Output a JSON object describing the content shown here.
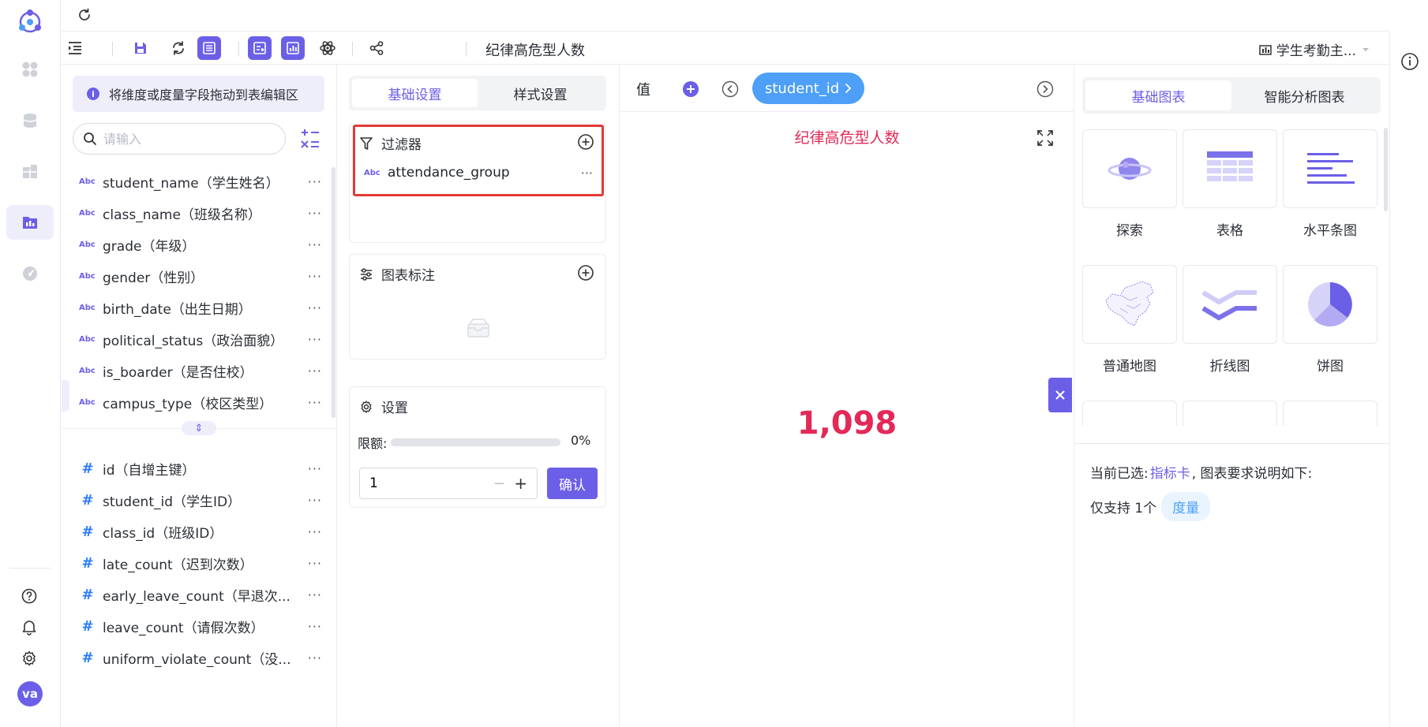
{
  "rail": {
    "items": [
      {
        "name": "rail-item-apps",
        "icon": "grid-icon",
        "active": false
      },
      {
        "name": "rail-item-datasource",
        "icon": "database-icon",
        "active": false
      },
      {
        "name": "rail-item-dataset",
        "icon": "table-icon",
        "active": false
      },
      {
        "name": "rail-item-analysis",
        "icon": "chart-folder-icon",
        "active": true
      },
      {
        "name": "rail-item-monitor",
        "icon": "gauge-icon",
        "active": false
      }
    ],
    "avatar": "va"
  },
  "toolbar": {
    "report_title": "纪律高危型人数",
    "dashboard": "学生考勤主..."
  },
  "fields_panel": {
    "hint": "将维度或度量字段拖动到表编辑区",
    "search_placeholder": "请输入",
    "dimensions": [
      {
        "type": "Abc",
        "label": "student_name（学生姓名）"
      },
      {
        "type": "Abc",
        "label": "class_name（班级名称）"
      },
      {
        "type": "Abc",
        "label": "grade（年级）"
      },
      {
        "type": "Abc",
        "label": "gender（性别）"
      },
      {
        "type": "Abc",
        "label": "birth_date（出生日期）"
      },
      {
        "type": "Abc",
        "label": "political_status（政治面貌）"
      },
      {
        "type": "Abc",
        "label": "is_boarder（是否住校）"
      },
      {
        "type": "Abc",
        "label": "campus_type（校区类型）"
      }
    ],
    "measures": [
      {
        "type": "#",
        "label": "id（自增主键）"
      },
      {
        "type": "#",
        "label": "student_id（学生ID）"
      },
      {
        "type": "#",
        "label": "class_id（班级ID）"
      },
      {
        "type": "#",
        "label": "late_count（迟到次数）"
      },
      {
        "type": "#",
        "label": "early_leave_count（早退次..."
      },
      {
        "type": "#",
        "label": "leave_count（请假次数）"
      },
      {
        "type": "#",
        "label": "uniform_violate_count（没..."
      }
    ],
    "more": "···"
  },
  "settings_panel": {
    "tabs": [
      "基础设置",
      "样式设置"
    ],
    "active_tab": 0,
    "filter": {
      "title": "过滤器",
      "item_type": "Abc",
      "item_label": "attendance_group"
    },
    "annotation": {
      "title": "图表标注"
    },
    "config": {
      "title": "设置",
      "quota_label": "限额:",
      "quota_value": 0,
      "quota_text": "0%",
      "input_value": "1",
      "confirm_label": "确认"
    }
  },
  "canvas": {
    "value_label": "值",
    "field_pill": "student_id",
    "chart_title": "纪律高危型人数",
    "metric_value": "1,098"
  },
  "chart_picker": {
    "tabs": [
      "基础图表",
      "智能分析图表"
    ],
    "active_tab": 0,
    "tiles": [
      {
        "label": "探索",
        "icon": "explore-planet-icon"
      },
      {
        "label": "表格",
        "icon": "table-chart-icon"
      },
      {
        "label": "水平条图",
        "icon": "horizontal-bar-icon"
      },
      {
        "label": "普通地图",
        "icon": "china-map-icon"
      },
      {
        "label": "折线图",
        "icon": "line-chart-icon"
      },
      {
        "label": "饼图",
        "icon": "pie-chart-icon"
      }
    ],
    "requirement_prefix": "当前已选:",
    "requirement_link": "指标卡",
    "requirement_suffix": ", 图表要求说明如下:",
    "support_prefix": "仅支持 1个",
    "support_tag": "度量"
  },
  "colors": {
    "accent": "#6c5fe7",
    "pill": "#4d9ff7",
    "metric": "#e32957",
    "highlight": "#e53935"
  }
}
